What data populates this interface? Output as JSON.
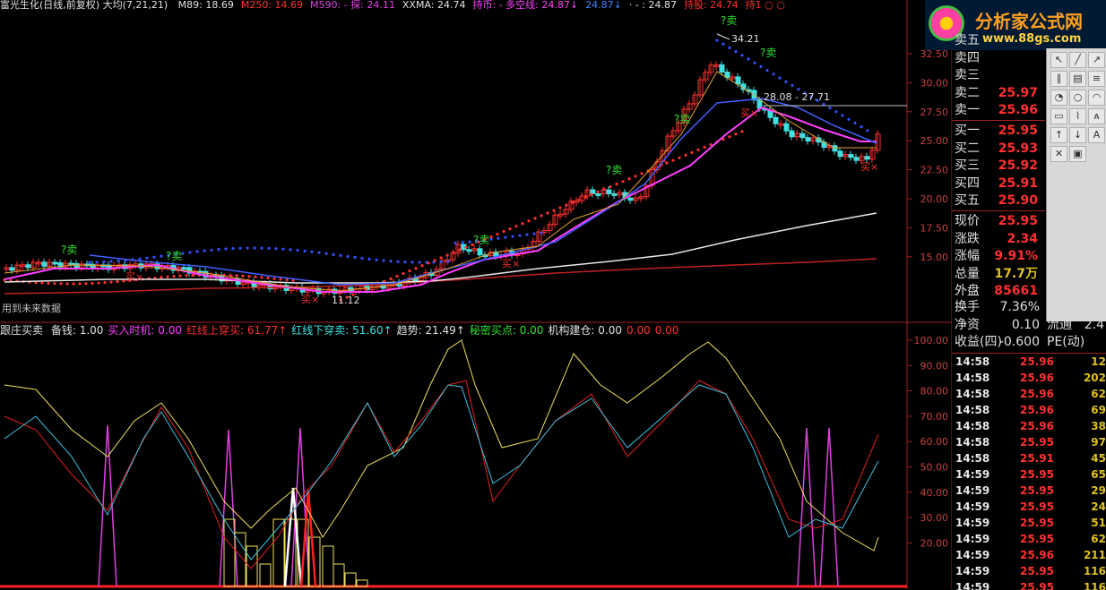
{
  "header": {
    "title": "富光生化(日线,前复权) 大均(7,21,21)",
    "items": [
      {
        "label": "M89: 18.69",
        "color": "#e0e0e0"
      },
      {
        "label": "M250: 14.69",
        "color": "#ff3030"
      },
      {
        "label": "M590: - 探: 24.11",
        "color": "#e040e0"
      },
      {
        "label": "XXMA: 24.74",
        "color": "#e0e0e0"
      },
      {
        "label": "持币: - 多空线: 24.87↓",
        "color": "#ff40ff"
      },
      {
        "label": "24.87↓",
        "color": "#4080ff"
      },
      {
        "label": "· - : 24.87",
        "color": "#e0e0e0"
      },
      {
        "label": "持股: 24.74",
        "color": "#ff3030"
      },
      {
        "label": "持1 ○ ○",
        "color": "#ff3030"
      }
    ]
  },
  "main_chart": {
    "y_axis": [
      "32.50",
      "30.00",
      "27.50",
      "25.00",
      "22.50",
      "20.00",
      "17.50",
      "15.00"
    ],
    "annotations": {
      "high": "34.21",
      "low": "11.12",
      "range_label": "28.08 - 27.71",
      "sell_markers": [
        "?卖",
        "?卖",
        "?卖",
        "?卖",
        "?卖",
        "?卖"
      ],
      "buy_markers": [
        "买",
        "买",
        "买",
        "买",
        "买",
        "买"
      ],
      "note": "用到未来数据"
    }
  },
  "indicator": {
    "name": "跟庄买卖",
    "items": [
      {
        "label": "备钱: 1.00",
        "color": "#e0e0e0"
      },
      {
        "label": "买入时机: 0.00",
        "color": "#ff40ff"
      },
      {
        "label": "红线上穿买: 61.77↑",
        "color": "#ff3030"
      },
      {
        "label": "红线下穿卖: 51.60↑",
        "color": "#40e0e0"
      },
      {
        "label": "趋势: 21.49↑",
        "color": "#e0e0e0"
      },
      {
        "label": "秘密买点: 0.00",
        "color": "#30e030"
      },
      {
        "label": "机构建仓: 0.00",
        "color": "#e0e0e0"
      },
      {
        "label": "0.00",
        "color": "#ff3030"
      },
      {
        "label": "0.00",
        "color": "#ff3030"
      }
    ],
    "y_axis": [
      "100.00",
      "90.00",
      "80.00",
      "70.00",
      "60.00",
      "50.00",
      "40.00",
      "30.00",
      "20.00"
    ]
  },
  "logo": {
    "name": "分析家公式网",
    "url": "www.88gs.com"
  },
  "quote_panel": {
    "sell": [
      {
        "label": "卖五",
        "value": ""
      },
      {
        "label": "卖四",
        "value": ""
      },
      {
        "label": "卖三",
        "value": ""
      },
      {
        "label": "卖二",
        "value": "25.97"
      },
      {
        "label": "卖一",
        "value": "25.96"
      }
    ],
    "buy": [
      {
        "label": "买一",
        "value": "25.95"
      },
      {
        "label": "买二",
        "value": "25.93"
      },
      {
        "label": "买三",
        "value": "25.92"
      },
      {
        "label": "买四",
        "value": "25.91"
      },
      {
        "label": "买五",
        "value": "25.90"
      }
    ],
    "stats": [
      {
        "label": "现价",
        "value": "25.95",
        "color": "#ff3030"
      },
      {
        "label": "涨跌",
        "value": "2.34",
        "color": "#ff3030"
      },
      {
        "label": "涨幅",
        "value": "9.91%",
        "color": "#ff3030"
      },
      {
        "label": "总量",
        "value": "17.7万",
        "color": "#e0c020"
      },
      {
        "label": "外盘",
        "value": "85661",
        "color": "#ff3030"
      }
    ],
    "extra": [
      {
        "label": "换手",
        "value": "7.36%",
        "label2": "",
        "value2": ""
      },
      {
        "label": "净资",
        "value": "0.10",
        "label2": "流通",
        "value2": "2.4"
      },
      {
        "label": "收益(四)",
        "value": "-0.600",
        "label2": "PE(动)",
        "value2": ""
      }
    ]
  },
  "ticks": [
    {
      "time": "14:58",
      "price": "25.96",
      "vol": "12",
      "color": "#ff3030"
    },
    {
      "time": "14:58",
      "price": "25.96",
      "vol": "202",
      "color": "#ff3030"
    },
    {
      "time": "14:58",
      "price": "25.96",
      "vol": "62",
      "color": "#ff3030"
    },
    {
      "time": "14:58",
      "price": "25.96",
      "vol": "69",
      "color": "#ff3030"
    },
    {
      "time": "14:58",
      "price": "25.96",
      "vol": "38",
      "color": "#ff3030"
    },
    {
      "time": "14:58",
      "price": "25.95",
      "vol": "97",
      "color": "#ff3030"
    },
    {
      "time": "14:58",
      "price": "25.91",
      "vol": "45",
      "color": "#ff3030"
    },
    {
      "time": "14:59",
      "price": "25.95",
      "vol": "65",
      "color": "#ff3030"
    },
    {
      "time": "14:59",
      "price": "25.95",
      "vol": "29",
      "color": "#ff3030"
    },
    {
      "time": "14:59",
      "price": "25.95",
      "vol": "24",
      "color": "#ff3030"
    },
    {
      "time": "14:59",
      "price": "25.95",
      "vol": "51",
      "color": "#ff3030"
    },
    {
      "time": "14:59",
      "price": "25.95",
      "vol": "62",
      "color": "#ff3030"
    },
    {
      "time": "14:59",
      "price": "25.96",
      "vol": "211",
      "color": "#ff3030"
    },
    {
      "time": "14:59",
      "price": "25.95",
      "vol": "116",
      "color": "#ff3030"
    },
    {
      "time": "14:59",
      "price": "25.95",
      "vol": "116",
      "color": "#ff3030"
    }
  ],
  "toolbar_icons": [
    "cursor-icon",
    "line-icon",
    "ray-icon",
    "parallel-icon",
    "channel-icon",
    "fib-icon",
    "gann-icon",
    "circle-icon",
    "arc-icon",
    "rect-icon",
    "cycle-icon",
    "text-icon",
    "arrow-up-icon",
    "arrow-down-icon",
    "label-a-icon",
    "delete-icon",
    "select-icon"
  ]
}
